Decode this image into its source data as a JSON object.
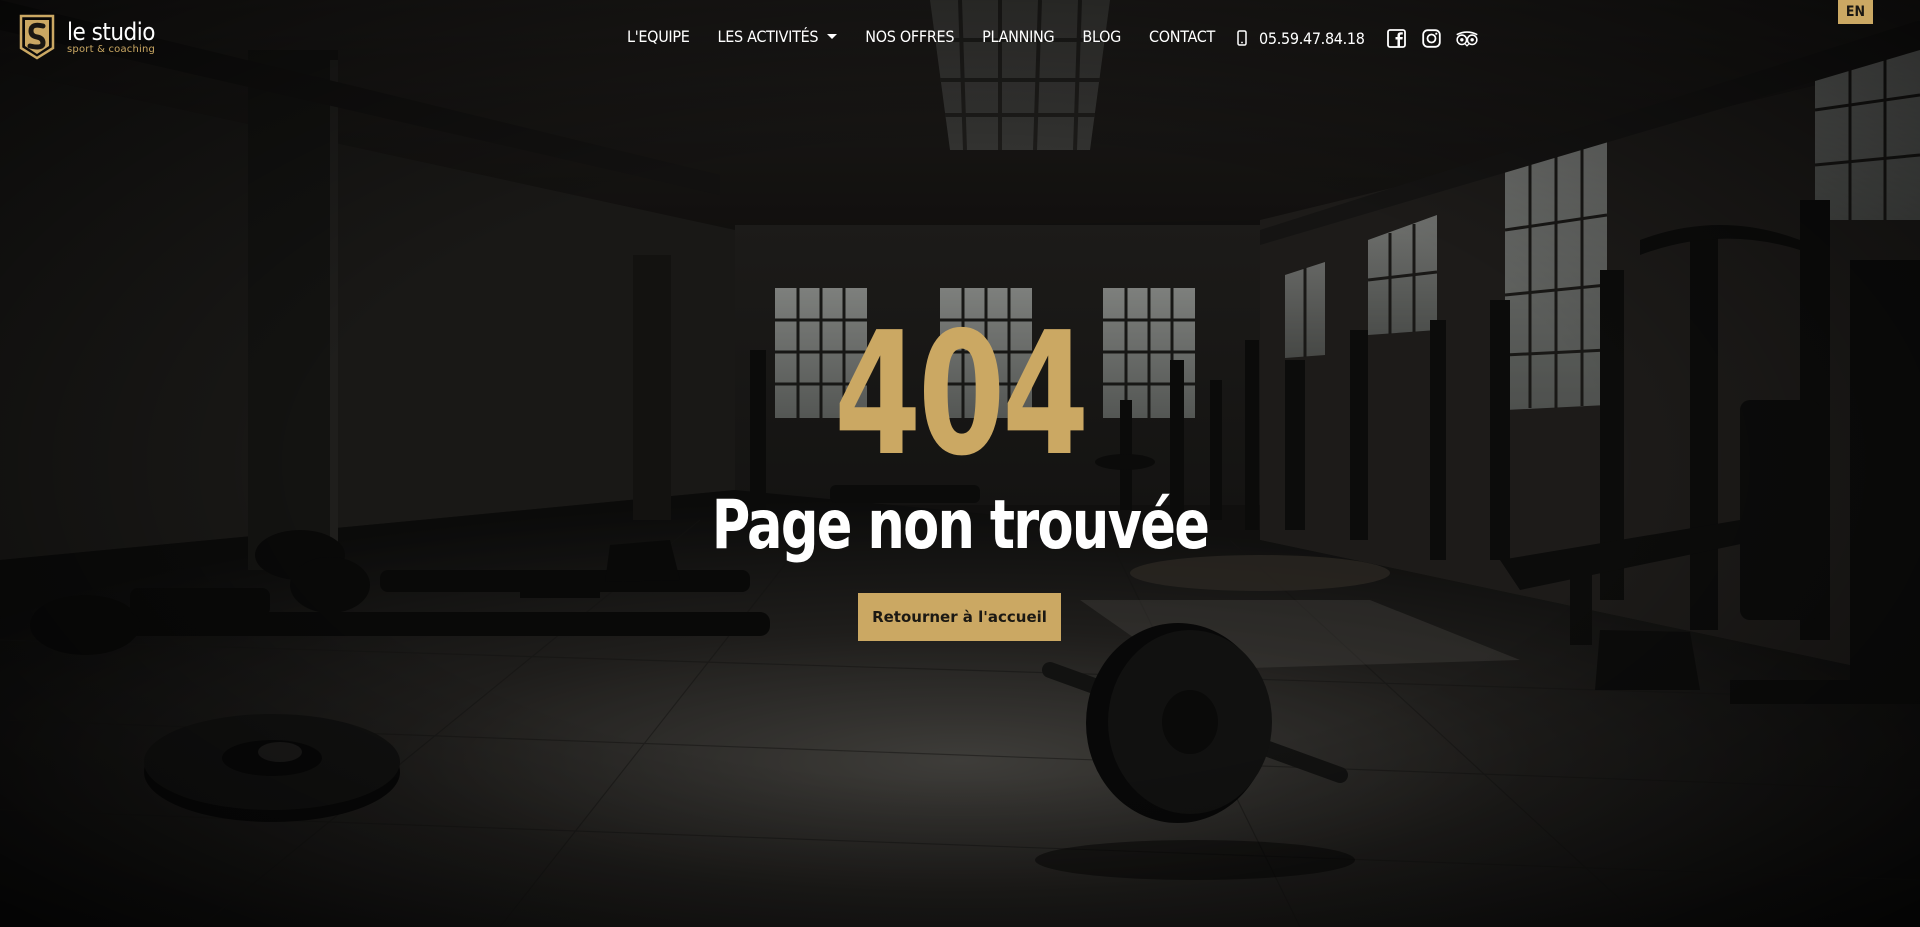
{
  "brand": {
    "name": "le studio",
    "tagline": "sport & coaching"
  },
  "nav": {
    "items": [
      {
        "label": "L'EQUIPE"
      },
      {
        "label": "LES ACTIVITÉS"
      },
      {
        "label": "NOS OFFRES"
      },
      {
        "label": "PLANNING"
      },
      {
        "label": "BLOG"
      },
      {
        "label": "CONTACT"
      }
    ]
  },
  "contact": {
    "phone": "05.59.47.84.18",
    "social_icons": [
      "facebook-icon",
      "instagram-icon",
      "tripadvisor-icon"
    ]
  },
  "language": {
    "label": "EN"
  },
  "error": {
    "code": "404",
    "message": "Page non trouvée",
    "button_label": "Retourner à l'accueil"
  },
  "colors": {
    "accent": "#cba863",
    "background": "#151412",
    "text": "#ffffff"
  }
}
